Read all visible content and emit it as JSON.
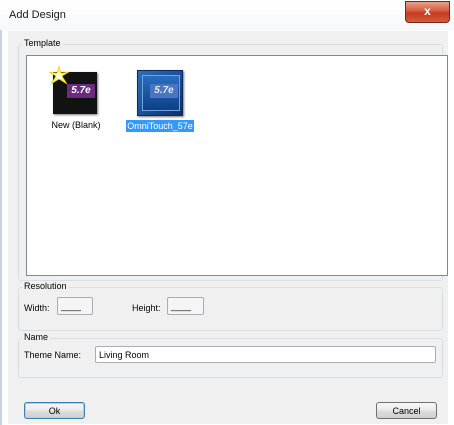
{
  "dialog": {
    "title": "Add Design",
    "close_glyph": "x"
  },
  "template": {
    "group_label": "Template",
    "items": [
      {
        "label": "New (Blank)",
        "badge": "5.7e",
        "icon": "new-blank-icon",
        "selected": false
      },
      {
        "label": "OmniTouch_57e",
        "badge": "5.7e",
        "icon": "omnitouch-template-icon",
        "selected": true
      }
    ]
  },
  "resolution": {
    "group_label": "Resolution",
    "width_label": "Width:",
    "width_value": "____",
    "height_label": "Height:",
    "height_value": "____"
  },
  "name": {
    "group_label": "Name",
    "theme_label": "Theme Name:",
    "theme_value": "Living Room"
  },
  "buttons": {
    "ok": "Ok",
    "cancel": "Cancel"
  },
  "colors": {
    "selection": "#3399ff",
    "badge_purple": "#6a2b7e",
    "close_red": "#c43a20"
  }
}
